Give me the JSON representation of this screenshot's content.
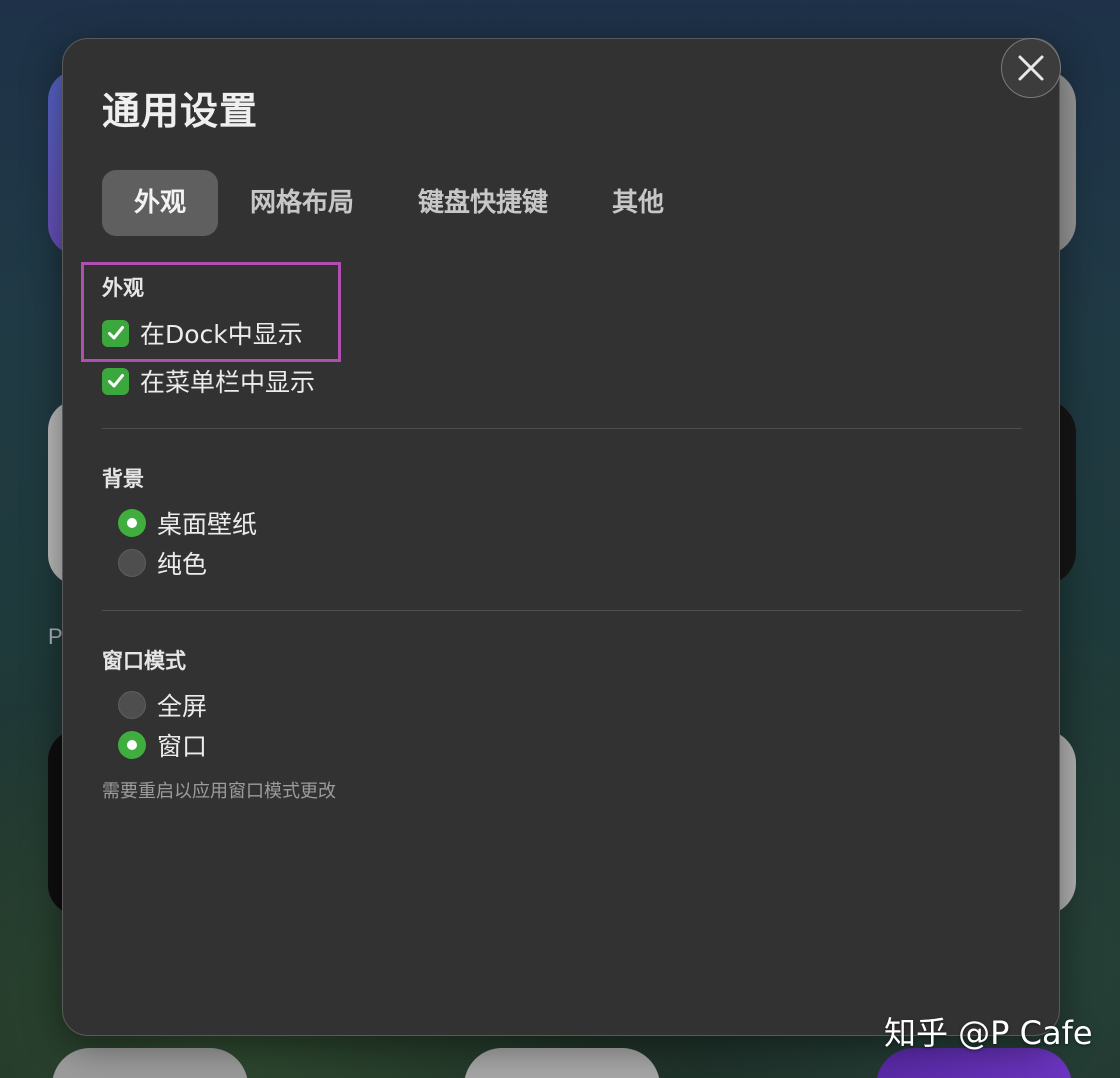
{
  "dialog": {
    "title": "通用设置",
    "close_icon": "close-icon"
  },
  "tabs": [
    {
      "label": "外观",
      "active": true
    },
    {
      "label": "网格布局",
      "active": false
    },
    {
      "label": "键盘快捷键",
      "active": false
    },
    {
      "label": "其他",
      "active": false
    }
  ],
  "appearance": {
    "section_label": "外观",
    "options": [
      {
        "label": "在Dock中显示",
        "checked": true
      },
      {
        "label": "在菜单栏中显示",
        "checked": true
      }
    ]
  },
  "background": {
    "section_label": "背景",
    "options": [
      {
        "label": "桌面壁纸",
        "selected": true
      },
      {
        "label": "纯色",
        "selected": false
      }
    ]
  },
  "window_mode": {
    "section_label": "窗口模式",
    "options": [
      {
        "label": "全屏",
        "selected": false
      },
      {
        "label": "窗口",
        "selected": true
      }
    ],
    "hint": "需要重启以应用窗口模式更改"
  },
  "background_app": {
    "partial_letter": "P"
  },
  "watermark": "知乎 @P Cafe",
  "colors": {
    "panel": "#323232",
    "accent_green": "#3ca73c",
    "highlight": "#b04fb0",
    "active_tab": "#5f5f5f"
  }
}
